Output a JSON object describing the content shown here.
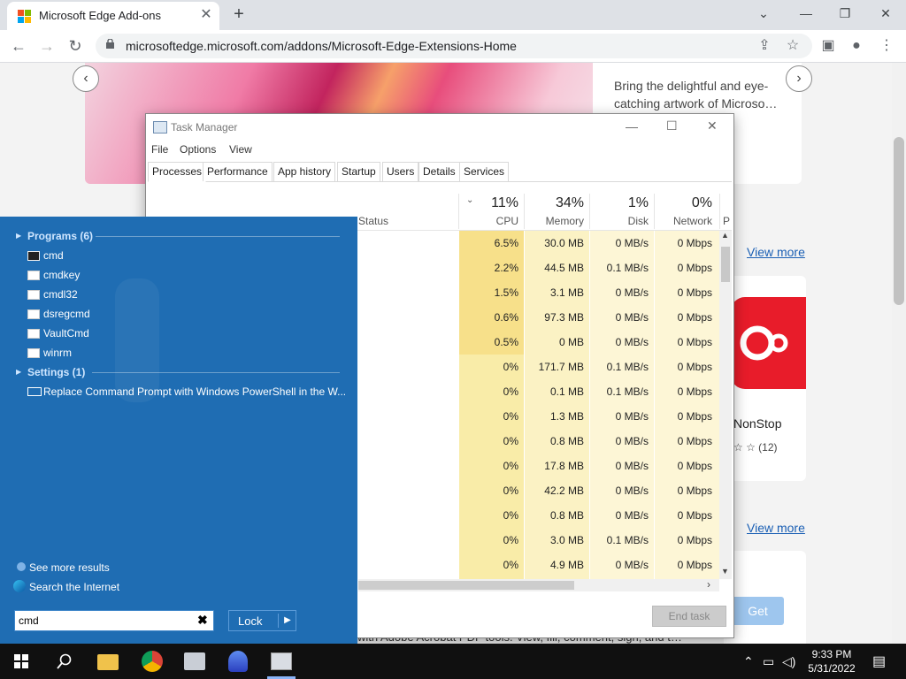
{
  "browser": {
    "tab_title": "Microsoft Edge Add-ons",
    "url": "microsoftedge.microsoft.com/addons/Microsoft-Edge-Extensions-Home",
    "new_tab": "+",
    "tab_close": "✕"
  },
  "page": {
    "hero_description": "Bring the delightful and eye-catching artwork of Microso…",
    "view_more_1": "View more",
    "view_more_2": "View more",
    "ext_name": "NonStop",
    "ext_rating": "☆ ☆ (12)",
    "get_label": "Get",
    "bottom_text": "with Adobe Acrobat PDF tools. View, fill, comment, sign, and t…"
  },
  "task_manager": {
    "title": "Task Manager",
    "menu": [
      "File",
      "Options",
      "View"
    ],
    "tabs": [
      "Processes",
      "Performance",
      "App history",
      "Startup",
      "Users",
      "Details",
      "Services"
    ],
    "status_col": "Status",
    "columns": [
      {
        "pct": "11%",
        "name": "CPU"
      },
      {
        "pct": "34%",
        "name": "Memory"
      },
      {
        "pct": "1%",
        "name": "Disk"
      },
      {
        "pct": "0%",
        "name": "Network"
      }
    ],
    "partial_col": "P",
    "rows": [
      {
        "cpu": "6.5%",
        "mem": "30.0 MB",
        "disk": "0 MB/s",
        "net": "0 Mbps"
      },
      {
        "cpu": "2.2%",
        "mem": "44.5 MB",
        "disk": "0.1 MB/s",
        "net": "0 Mbps"
      },
      {
        "cpu": "1.5%",
        "mem": "3.1 MB",
        "disk": "0 MB/s",
        "net": "0 Mbps"
      },
      {
        "cpu": "0.6%",
        "mem": "97.3 MB",
        "disk": "0 MB/s",
        "net": "0 Mbps"
      },
      {
        "cpu": "0.5%",
        "mem": "0 MB",
        "disk": "0 MB/s",
        "net": "0 Mbps"
      },
      {
        "cpu": "0%",
        "mem": "171.7 MB",
        "disk": "0.1 MB/s",
        "net": "0 Mbps"
      },
      {
        "cpu": "0%",
        "mem": "0.1 MB",
        "disk": "0.1 MB/s",
        "net": "0 Mbps"
      },
      {
        "cpu": "0%",
        "mem": "1.3 MB",
        "disk": "0 MB/s",
        "net": "0 Mbps"
      },
      {
        "cpu": "0%",
        "mem": "0.8 MB",
        "disk": "0 MB/s",
        "net": "0 Mbps"
      },
      {
        "cpu": "0%",
        "mem": "17.8 MB",
        "disk": "0 MB/s",
        "net": "0 Mbps"
      },
      {
        "cpu": "0%",
        "mem": "42.2 MB",
        "disk": "0 MB/s",
        "net": "0 Mbps"
      },
      {
        "cpu": "0%",
        "mem": "0.8 MB",
        "disk": "0 MB/s",
        "net": "0 Mbps"
      },
      {
        "cpu": "0%",
        "mem": "3.0 MB",
        "disk": "0.1 MB/s",
        "net": "0 Mbps"
      },
      {
        "cpu": "0%",
        "mem": "4.9 MB",
        "disk": "0 MB/s",
        "net": "0 Mbps"
      }
    ],
    "end_task": "End task"
  },
  "start_menu": {
    "programs_header": "Programs (6)",
    "programs": [
      "cmd",
      "cmdkey",
      "cmdl32",
      "dsregcmd",
      "VaultCmd",
      "winrm"
    ],
    "settings_header": "Settings (1)",
    "settings": [
      "Replace Command Prompt with Windows PowerShell in the W..."
    ],
    "see_more": "See more results",
    "search_internet": "Search the Internet",
    "search_value": "cmd",
    "search_clear": "✖",
    "lock_label": "Lock",
    "lock_arrow": "▶"
  },
  "taskbar": {
    "time": "9:33 PM",
    "date": "5/31/2022"
  },
  "colors": {
    "start_bg": "#1f6db3",
    "taskbar_bg": "#101010",
    "cpu_highlight": "#f7e08a",
    "link": "#1a5fb4"
  }
}
